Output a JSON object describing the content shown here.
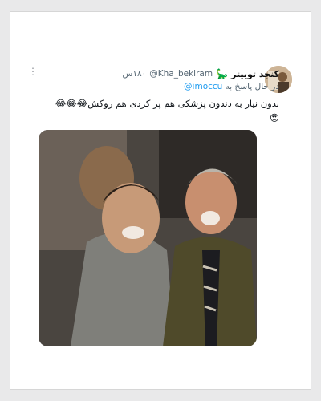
{
  "tweet": {
    "display_name": "کنجد توییتر",
    "name_emoji": "🦕",
    "handle": "@Kha_bekiram",
    "age": "۱۸۰س",
    "reply_prefix": "در حال پاسخ به",
    "reply_to": "@imoccu",
    "text": "بدون نیاز به دندون پزشکی هم پر کردی هم روکش😂😂😂😍"
  },
  "icons": {
    "more": "more-vertical-icon",
    "avatar": "profile-avatar",
    "media": "laughing-men-photo"
  },
  "colors": {
    "link": "#1d9bf0",
    "secondary": "#536471",
    "text": "#0f1419"
  }
}
